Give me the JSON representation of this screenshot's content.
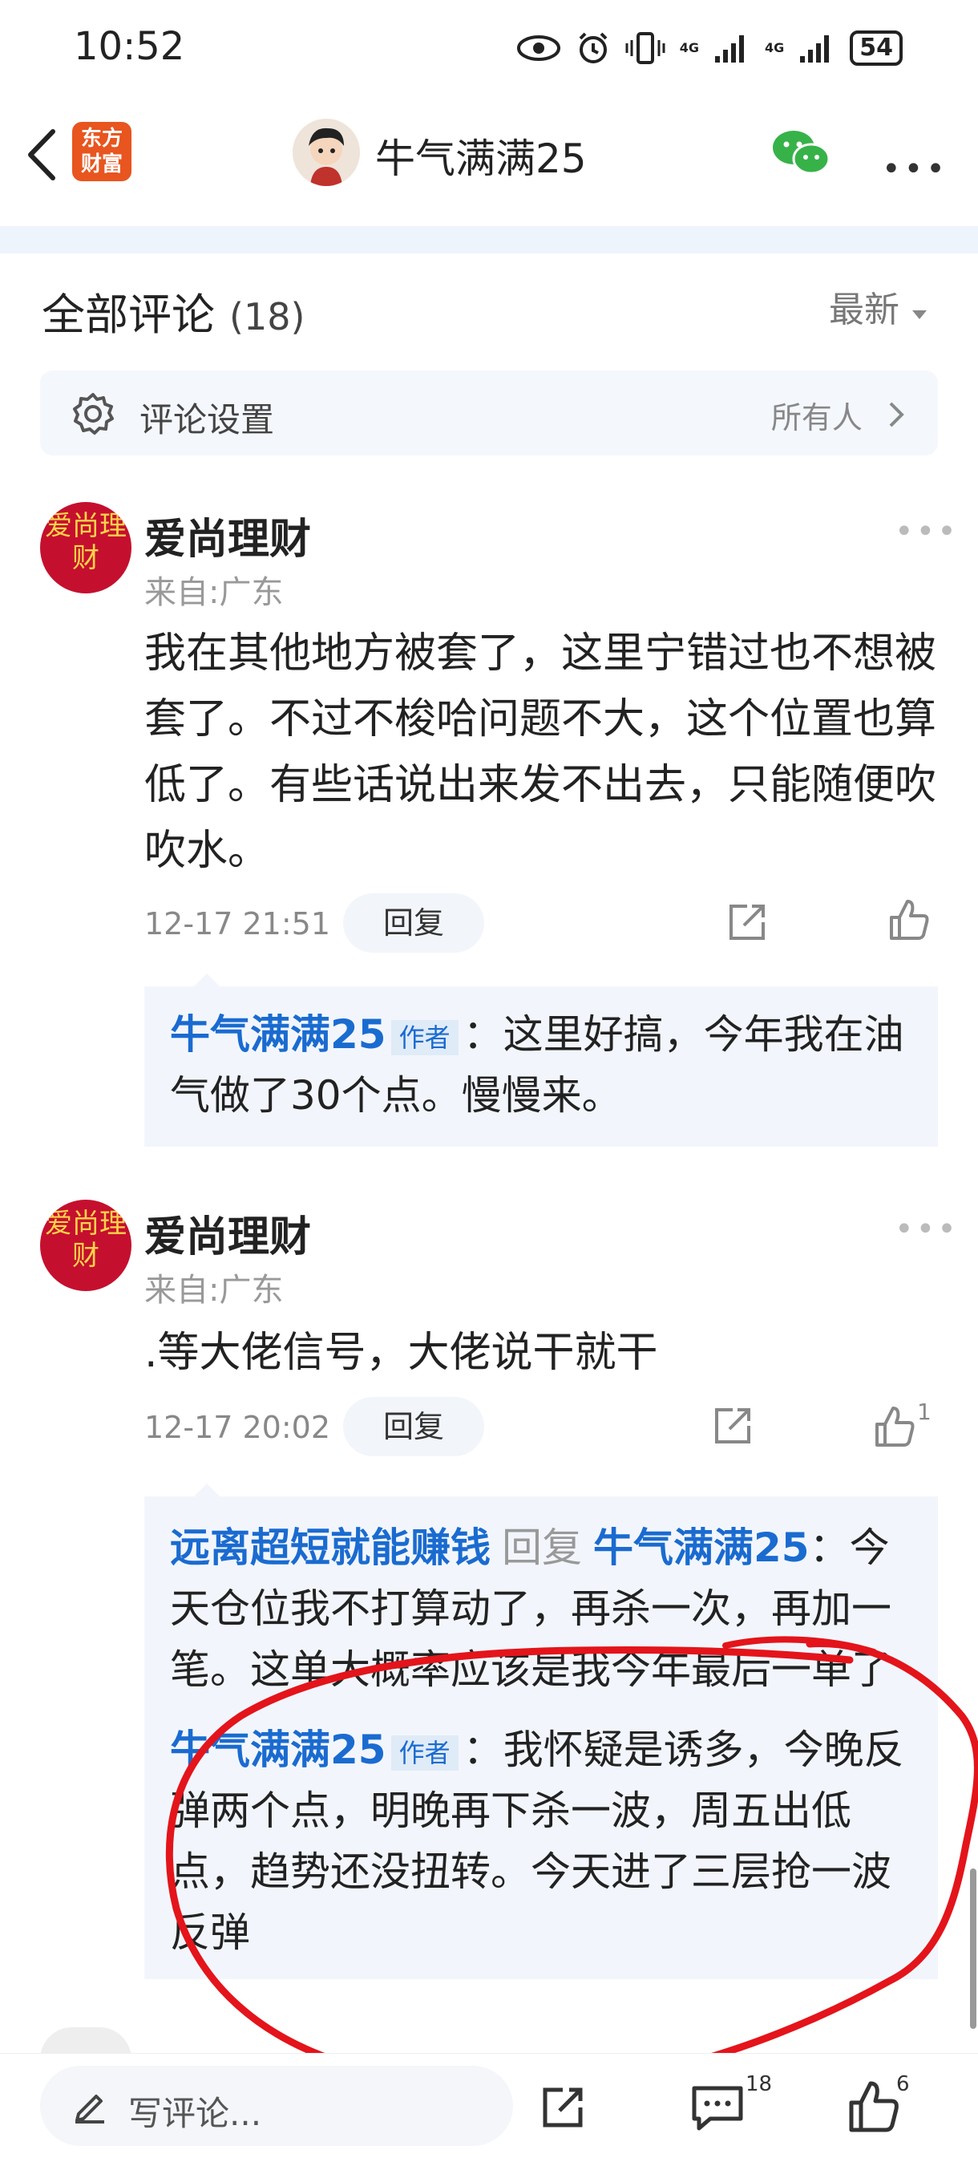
{
  "status_bar": {
    "time": "10:52",
    "network_1": "4G",
    "network_2": "4G",
    "battery": "54"
  },
  "nav": {
    "logo_line1": "东方",
    "logo_line2": "财富",
    "title": "牛气满满25"
  },
  "comments_header": {
    "title": "全部评论",
    "count": "(18)",
    "sort_label": "最新"
  },
  "comment_settings": {
    "label": "评论设置",
    "value": "所有人"
  },
  "comments": [
    {
      "avatar_text": "爱尚理财",
      "username": "爱尚理财",
      "location": "来自:广东",
      "text": "我在其他地方被套了，这里宁错过也不想被套了。不过不梭哈问题不大，这个位置也算低了。有些话说出来发不出去，只能随便吹吹水。",
      "time": "12-17 21:51",
      "reply_label": "回复",
      "replies": [
        {
          "author": "牛气满满25",
          "tag": "作者",
          "text": "：这里好搞，今年我在油气做了30个点。慢慢来。"
        }
      ]
    },
    {
      "avatar_text": "爱尚理财",
      "username": "爱尚理财",
      "location": "来自:广东",
      "text": ".等大佬信号，大佬说干就干",
      "time": "12-17 20:02",
      "reply_label": "回复",
      "like_count": "1",
      "replies": [
        {
          "author": "远离超短就能赚钱",
          "reply_word": "回复",
          "target": "牛气满满25",
          "text": "：今天仓位我不打算动了，再杀一次，再加一笔。这单大概率应该是我今年最后一单了"
        },
        {
          "author": "牛气满满25",
          "tag": "作者",
          "text": "：我怀疑是诱多，今晚反弹两个点，明晚再下杀一波，周五出低点，趋势还没扭转。今天进了三层抢一波反弹"
        }
      ]
    }
  ],
  "bottom_bar": {
    "placeholder": "写评论...",
    "comment_count": "18",
    "like_count": "6"
  },
  "colors": {
    "link_blue": "#1a6bd0",
    "annotation_red": "#e4141b",
    "brand_orange": "#e8551f"
  }
}
